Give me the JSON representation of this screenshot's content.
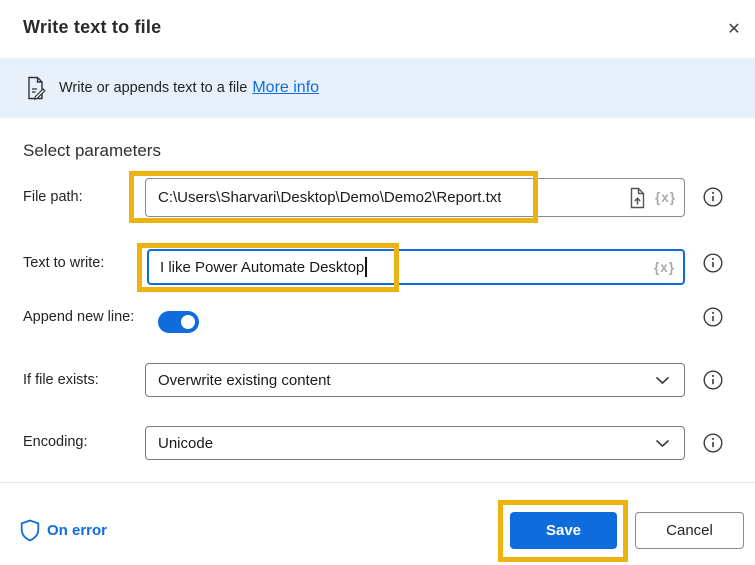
{
  "colors": {
    "accent": "#0f6cdd",
    "annotation_yellow": "#eeb211",
    "banner_background": "#e8f1fb"
  },
  "dialog": {
    "title": "Write text to file",
    "close_icon": "✕"
  },
  "banner": {
    "icon": "write-file-icon",
    "text": "Write or appends text to a file",
    "link": "More info"
  },
  "section_heading": "Select parameters",
  "fields": {
    "file_path": {
      "label": "File path:",
      "value": "C:\\Users\\Sharvari\\Desktop\\Demo\\Demo2\\Report.txt",
      "var_picker": "{x}",
      "highlighted": true
    },
    "text_to_write": {
      "label": "Text to write:",
      "value": "I like Power Automate Desktop",
      "var_picker": "{x}",
      "focused": true,
      "highlighted": true
    },
    "append_new_line": {
      "label": "Append new line:",
      "state": "on"
    },
    "if_file_exists": {
      "label": "If file exists:",
      "value": "Overwrite existing content"
    },
    "encoding": {
      "label": "Encoding:",
      "value": "Unicode"
    }
  },
  "footer": {
    "on_error": "On error",
    "save": "Save",
    "cancel": "Cancel",
    "save_highlighted": true
  }
}
